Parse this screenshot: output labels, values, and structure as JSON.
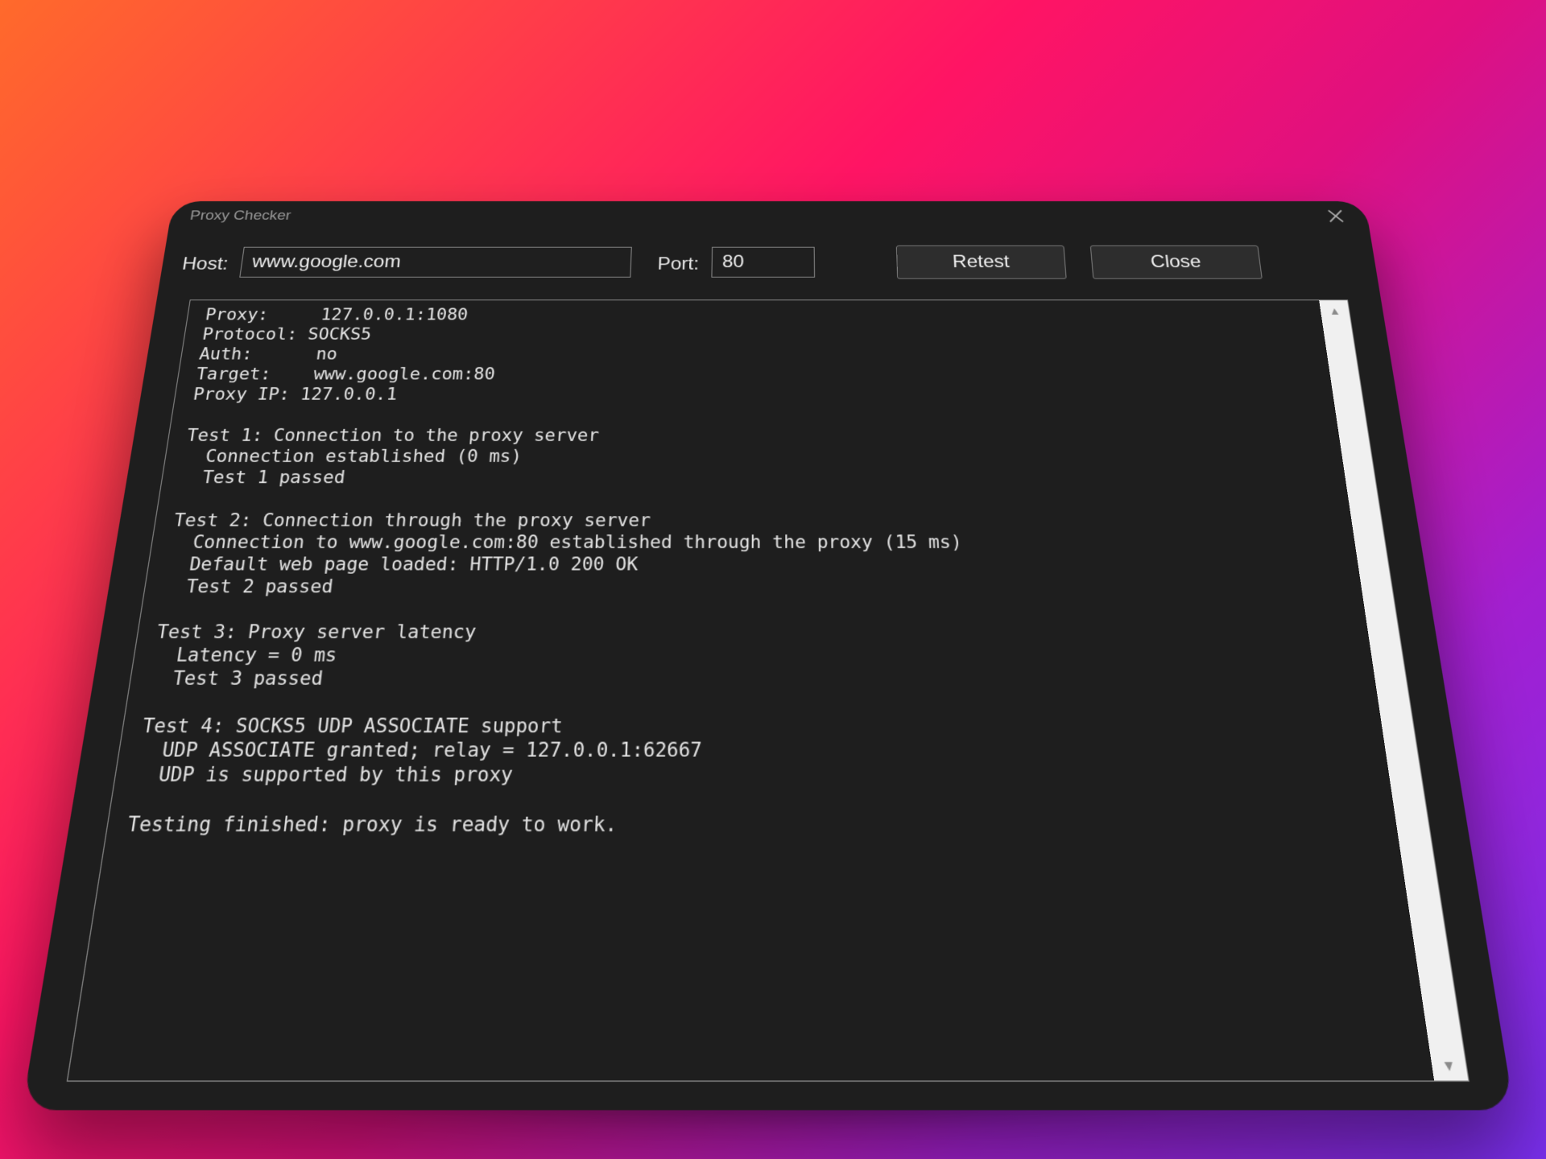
{
  "window": {
    "title": "Proxy Checker"
  },
  "toolbar": {
    "host_label": "Host:",
    "host_value": "www.google.com",
    "port_label": "Port:",
    "port_value": "80",
    "retest_label": "Retest",
    "close_label": "Close"
  },
  "log": {
    "lines": [
      " Proxy:     127.0.0.1:1080",
      " Protocol: SOCKS5",
      " Auth:      no",
      " Target:    www.google.com:80",
      " Proxy IP: 127.0.0.1",
      "",
      " Test 1: Connection to the proxy server",
      "   Connection established (0 ms)",
      "   Test 1 passed",
      "",
      " Test 2: Connection through the proxy server",
      "   Connection to www.google.com:80 established through the proxy (15 ms)",
      "   Default web page loaded: HTTP/1.0 200 OK",
      "   Test 2 passed",
      "",
      " Test 3: Proxy server latency",
      "   Latency = 0 ms",
      "   Test 3 passed",
      "",
      " Test 4: SOCKS5 UDP ASSOCIATE support",
      "   UDP ASSOCIATE granted; relay = 127.0.0.1:62667",
      "   UDP is supported by this proxy",
      "",
      " Testing finished: proxy is ready to work."
    ]
  },
  "icons": {
    "close": "close-icon",
    "scroll_up": "scroll-up-arrow-icon",
    "scroll_down": "scroll-down-arrow-icon"
  },
  "colors": {
    "window_bg": "#1e1e1e",
    "text": "#e4e4e4",
    "border": "#8a8a8a",
    "button_bg": "#2d2d2d",
    "scrollbar_bg": "#f0f0f0"
  }
}
